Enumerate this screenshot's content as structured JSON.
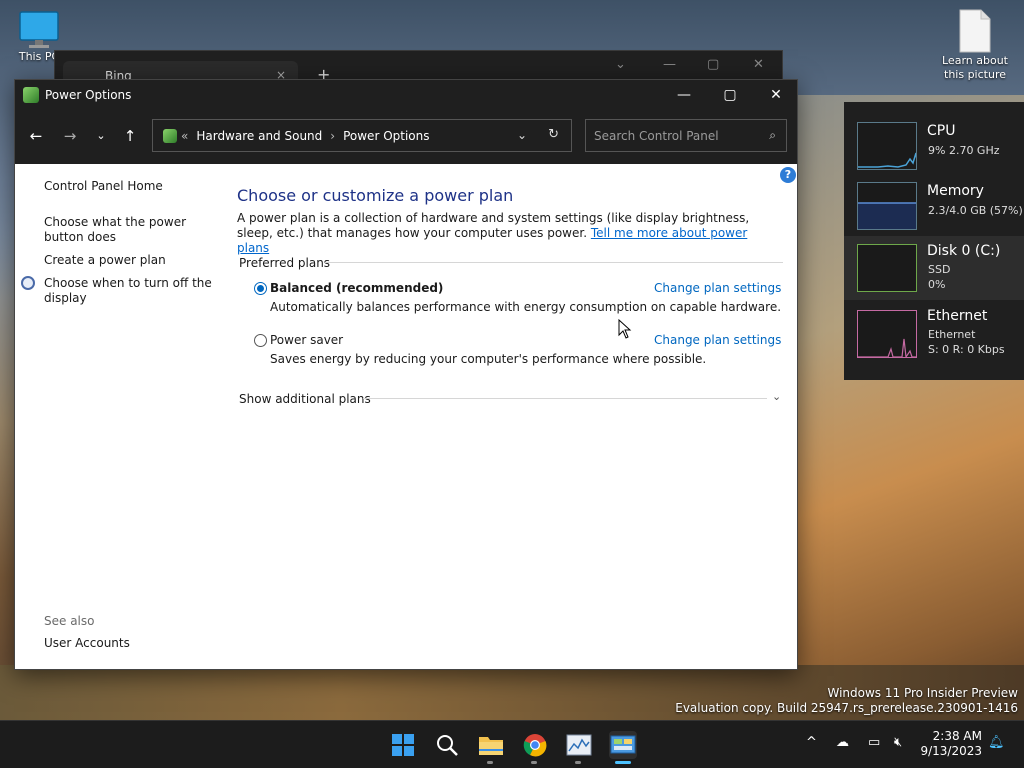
{
  "desktop": {
    "icons": [
      {
        "label": "This PC"
      },
      {
        "label": "Learn about this picture"
      }
    ],
    "watermark_line1": "Windows 11 Pro Insider Preview",
    "watermark_line2": "Evaluation copy. Build 25947.rs_prerelease.230901-1416"
  },
  "background_window": {
    "tab_title": "Bing",
    "close_glyph": "×",
    "new_tab_glyph": "+"
  },
  "window": {
    "title": "Power Options",
    "breadcrumb": {
      "overflow": "«",
      "items": [
        "Hardware and Sound",
        "Power Options"
      ],
      "separator": "›"
    },
    "search_placeholder": "Search Control Panel",
    "help_glyph": "?"
  },
  "sidebar": {
    "links": [
      "Control Panel Home",
      "Choose what the power button does",
      "Create a power plan",
      "Choose when to turn off the display"
    ],
    "see_also_title": "See also",
    "see_also_links": [
      "User Accounts"
    ]
  },
  "main": {
    "heading": "Choose or customize a power plan",
    "intro": "A power plan is a collection of hardware and system settings (like display brightness, sleep, etc.) that manages how your computer uses power.",
    "intro_link": "Tell me more about power plans",
    "group_title": "Preferred plans",
    "plans": [
      {
        "name": "Balanced (recommended)",
        "selected": true,
        "description": "Automatically balances performance with energy consumption on capable hardware.",
        "action": "Change plan settings"
      },
      {
        "name": "Power saver",
        "selected": false,
        "description": "Saves energy by reducing your computer's performance where possible.",
        "action": "Change plan settings"
      }
    ],
    "show_more": "Show additional plans"
  },
  "performance": {
    "rows": [
      {
        "name": "CPU",
        "lines": [
          "9% 2.70 GHz"
        ],
        "color": "#4aa3d8"
      },
      {
        "name": "Memory",
        "lines": [
          "2.3/4.0 GB (57%)"
        ],
        "color": "#5b8dd6"
      },
      {
        "name": "Disk 0 (C:)",
        "lines": [
          "SSD",
          "0%"
        ],
        "color": "#6ea84a"
      },
      {
        "name": "Ethernet",
        "lines": [
          "Ethernet",
          "S: 0 R: 0 Kbps"
        ],
        "color": "#c56aa3"
      }
    ]
  },
  "taskbar": {
    "apps": [
      "start-icon",
      "search-icon",
      "file-explorer-icon",
      "chrome-icon",
      "performance-monitor-icon",
      "control-panel-icon"
    ],
    "tray_chevron": "^",
    "clock_time": "2:38 AM",
    "clock_date": "9/13/2023"
  },
  "colors": {
    "accent": "#0067c0",
    "link": "#0066cc",
    "heading": "#1e3287",
    "titlebar": "#1f1f1f"
  }
}
